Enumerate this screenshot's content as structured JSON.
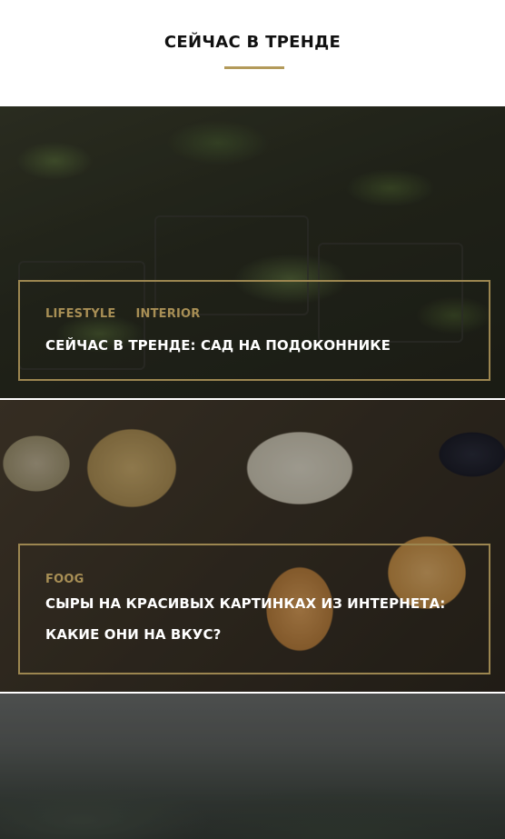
{
  "section": {
    "title": "СЕЙЧАС В ТРЕНДЕ",
    "accent_color": "#b39a5a"
  },
  "posts": [
    {
      "tags": [
        "LIFESTYLE",
        "INTERIOR"
      ],
      "title": "СЕЙЧАС В ТРЕНДЕ: САД НА ПОДОКОННИКЕ",
      "image": "seedlings-photo"
    },
    {
      "tags": [
        "FOOG"
      ],
      "title": "СЫРЫ НА КРАСИВЫХ КАРТИНКАХ ИЗ ИНТЕРНЕТА: КАКИЕ ОНИ НА ВКУС?",
      "image": "cheese-photo"
    },
    {
      "tags": [],
      "title": "",
      "image": "mountains-photo"
    }
  ]
}
